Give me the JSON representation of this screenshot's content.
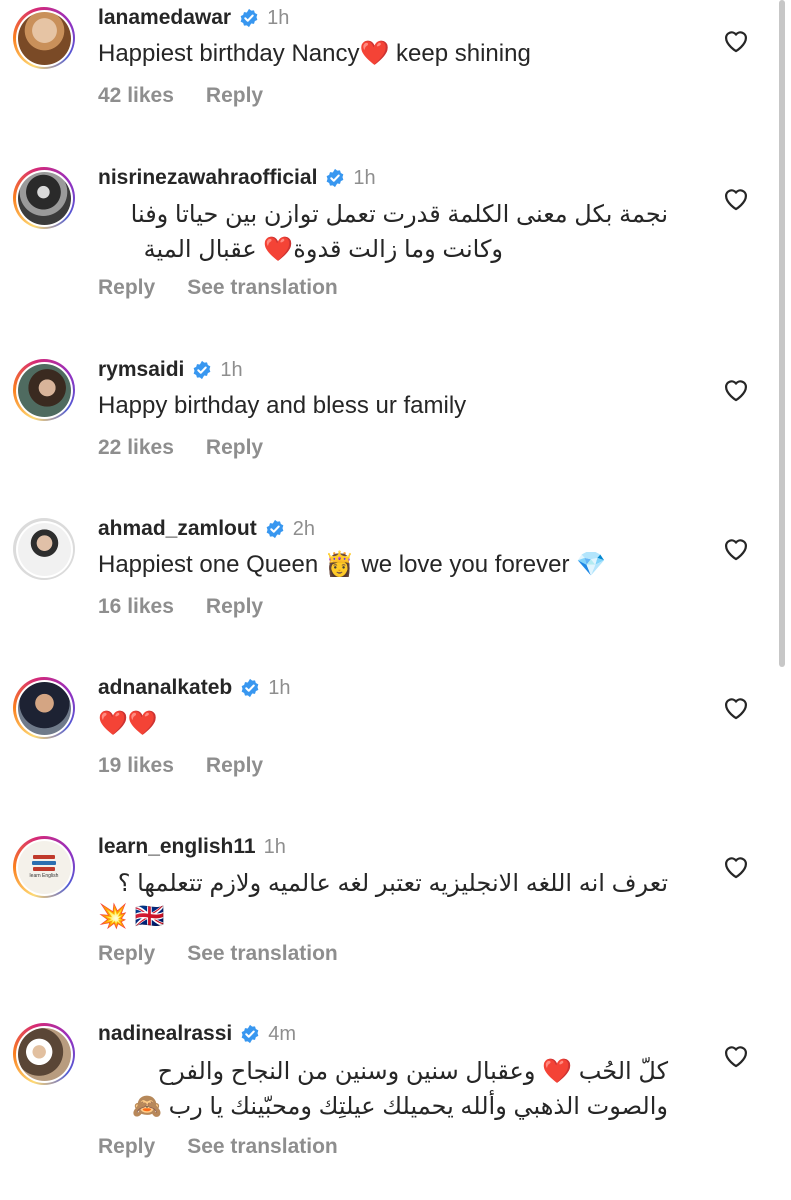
{
  "comments": [
    {
      "username": "lanamedawar",
      "verified": true,
      "time": "1h",
      "text": "Happiest birthday Nancy",
      "text_after": " keep shining",
      "emoji": "❤️",
      "likes": "42 likes",
      "reply": "Reply"
    },
    {
      "username": "nisrinezawahraofficial",
      "verified": true,
      "time": "1h",
      "line1": "نجمة بكل معنى الكلمة قدرت تعمل توازن بين حياتا وفنا",
      "line2_pre": "وكانت وما زالت قدوة",
      "line2_emoji": "❤️",
      "line2_post": "عقبال المية",
      "reply": "Reply",
      "see_translation": "See translation"
    },
    {
      "username": "rymsaidi",
      "verified": true,
      "time": "1h",
      "text": "Happy birthday and bless ur family",
      "likes": "22 likes",
      "reply": "Reply"
    },
    {
      "username": "ahmad_zamlout",
      "verified": true,
      "time": "2h",
      "text_pre": "Happiest one Queen ",
      "emoji1": "👸",
      "text_mid": " we love you forever ",
      "emoji2": "💎",
      "likes": "16 likes",
      "reply": "Reply"
    },
    {
      "username": "adnanalkateb",
      "verified": true,
      "time": "1h",
      "text": "❤️❤️",
      "likes": "19 likes",
      "reply": "Reply"
    },
    {
      "username": "learn_english11",
      "verified": false,
      "time": "1h",
      "line1": "تعرف انه اللغه الانجليزيه تعتبر لغه عالميه ولازم تتعلمها ؟",
      "line2": "💥 🇬🇧",
      "reply": "Reply",
      "see_translation": "See translation",
      "avatar_text": "learn English"
    },
    {
      "username": "nadinealrassi",
      "verified": true,
      "time": "4m",
      "line1_pre": "كلّ الحُب",
      "line1_emoji": "❤️",
      "line1_post": "وعقبال سنين وسنين من النجاح والفرح",
      "line2": "والصوت الذهبي وألله يحميلك عيلتِك ومحبّينك يا رب 🙈",
      "reply": "Reply",
      "see_translation": "See translation"
    }
  ],
  "colors": {
    "verified": "#3897f0",
    "muted": "#8e8e8e",
    "heart": "#ed2d3f",
    "text": "#262626"
  },
  "icons": {
    "like": "heart-outline-icon",
    "verified": "verified-badge-icon"
  }
}
